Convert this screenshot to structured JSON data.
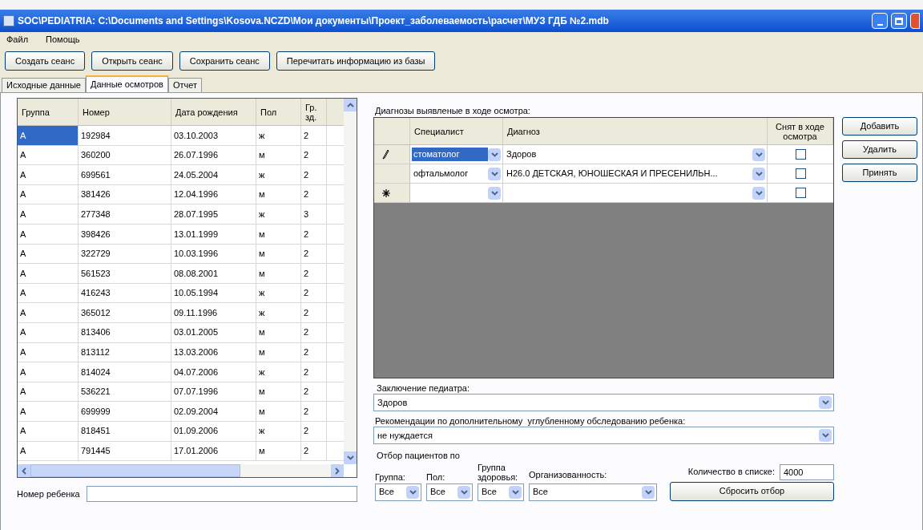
{
  "window": {
    "title": "SOC\\PEDIATRIA: C:\\Documents and Settings\\Kosova.NCZD\\Мои документы\\Проект_заболеваемость\\расчет\\МУЗ ГДБ №2.mdb"
  },
  "menu": [
    "Файл",
    "Помощь"
  ],
  "toolbar_buttons": [
    "Создать сеанс",
    "Открыть сеанс",
    "Сохранить сеанс",
    "Перечитать информацию из базы"
  ],
  "tabs": [
    {
      "label": "Исходные данные",
      "selected": false
    },
    {
      "label": "Данные осмотров",
      "selected": true
    },
    {
      "label": "Отчет",
      "selected": false
    }
  ],
  "patients": {
    "columns": [
      "Группа",
      "Номер",
      "Дата рождения",
      "Пол",
      "Гр. зд."
    ],
    "rows": [
      {
        "cells": [
          "A",
          "192984",
          "03.10.2003",
          "ж",
          "2"
        ],
        "selected": true
      },
      {
        "cells": [
          "A",
          "360200",
          "26.07.1996",
          "м",
          "2"
        ],
        "selected": false
      },
      {
        "cells": [
          "A",
          "699561",
          "24.05.2004",
          "ж",
          "2"
        ],
        "selected": false
      },
      {
        "cells": [
          "A",
          "381426",
          "12.04.1996",
          "м",
          "2"
        ],
        "selected": false
      },
      {
        "cells": [
          "A",
          "277348",
          "28.07.1995",
          "ж",
          "3"
        ],
        "selected": false
      },
      {
        "cells": [
          "A",
          "398426",
          "13.01.1999",
          "м",
          "2"
        ],
        "selected": false
      },
      {
        "cells": [
          "A",
          "322729",
          "10.03.1996",
          "м",
          "2"
        ],
        "selected": false
      },
      {
        "cells": [
          "A",
          "561523",
          "08.08.2001",
          "м",
          "2"
        ],
        "selected": false
      },
      {
        "cells": [
          "A",
          "416243",
          "10.05.1994",
          "ж",
          "2"
        ],
        "selected": false
      },
      {
        "cells": [
          "A",
          "365012",
          "09.11.1996",
          "ж",
          "2"
        ],
        "selected": false
      },
      {
        "cells": [
          "A",
          "813406",
          "03.01.2005",
          "м",
          "2"
        ],
        "selected": false
      },
      {
        "cells": [
          "A",
          "813112",
          "13.03.2006",
          "м",
          "2"
        ],
        "selected": false
      },
      {
        "cells": [
          "A",
          "814024",
          "04.07.2006",
          "ж",
          "2"
        ],
        "selected": false
      },
      {
        "cells": [
          "A",
          "536221",
          "07.07.1996",
          "м",
          "2"
        ],
        "selected": false
      },
      {
        "cells": [
          "A",
          "699999",
          "02.09.2004",
          "м",
          "2"
        ],
        "selected": false
      },
      {
        "cells": [
          "A",
          "818451",
          "01.09.2006",
          "ж",
          "2"
        ],
        "selected": false
      },
      {
        "cells": [
          "A",
          "791445",
          "17.01.2006",
          "м",
          "2"
        ],
        "selected": false
      }
    ],
    "child_number_label": "Номер ребенка"
  },
  "diagnoses": {
    "label": "Диагнозы выявленые в ходе осмотра:",
    "columns": [
      "Специалист",
      "Диагноз",
      "Снят в ходе осмотра"
    ],
    "rows": [
      {
        "kind": "editing",
        "specialist": "стоматолог",
        "specialist_selected": true,
        "diagnosis": "Здоров",
        "checked": false
      },
      {
        "kind": "normal",
        "specialist": "офтальмолог",
        "specialist_selected": false,
        "diagnosis": "H26.0 ДЕТСКАЯ, ЮНОШЕСКАЯ И ПРЕСЕНИЛЬН...",
        "checked": false
      },
      {
        "kind": "new",
        "checked": false
      }
    ]
  },
  "side_buttons": [
    "Добавить",
    "Удалить",
    "Принять"
  ],
  "conclusion": {
    "label": "Заключение педиатра:",
    "value": "Здоров"
  },
  "recommendations": {
    "label": "Рекомендации по дополнительному  углубленному обследованию ребенка:",
    "value": "не нуждается"
  },
  "filter": {
    "title": "Отбор пациентов по",
    "group": {
      "label": "Группа:",
      "value": "Все"
    },
    "sex": {
      "label": "Пол:",
      "value": "Все"
    },
    "health_group": {
      "label": "Группа здоровья:",
      "value": "Все"
    },
    "organized": {
      "label": "Организованность:",
      "value": "Все"
    },
    "count_label": "Количество в списке:",
    "count": "4000",
    "reset_button": "Сбросить отбор"
  }
}
